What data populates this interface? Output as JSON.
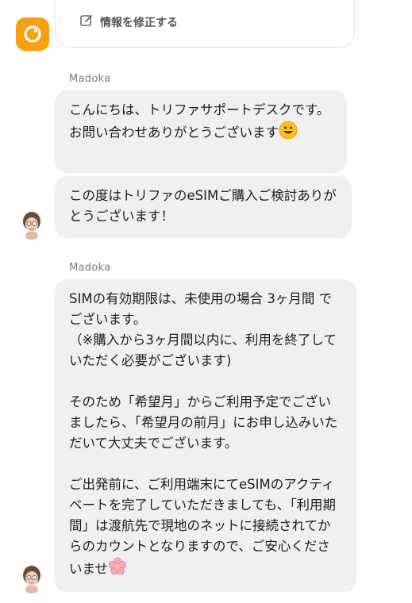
{
  "top_card": {
    "edit_label": "情報を修正する"
  },
  "messages": [
    {
      "sender": "Madoka",
      "bubbles": [
        {
          "text": "こんにちは、トリファサポートデスクです。お問い合わせありがとうございます",
          "emoji": "smiley-emoji"
        },
        {
          "text": "この度はトリファのeSIMご購入ご検討ありがとうございます！"
        }
      ]
    },
    {
      "sender": "Madoka",
      "bubbles": [
        {
          "text": "SIMの有効期限は、未使用の場合 3ヶ月間 でございます。\n（※購入から3ヶ月間以内に、利用を終了していただく必要がございます)\n\nそのため「希望月」からご利用予定でございましたら、「希望月の前月」にお申し込みいただいて大丈夫でございます。\n\nご出発前に、ご利用端末にてeSIMのアクティベートを完了していただきましても、「利用期間」は渡航先で現地のネットに接続されてからのカウントとなりますので、ご安心くださいませ",
          "emoji": "cherry-blossom-emoji"
        }
      ]
    }
  ],
  "colors": {
    "brand_orange": "#f8a00e",
    "bubble_bg": "#f0f0f0"
  }
}
